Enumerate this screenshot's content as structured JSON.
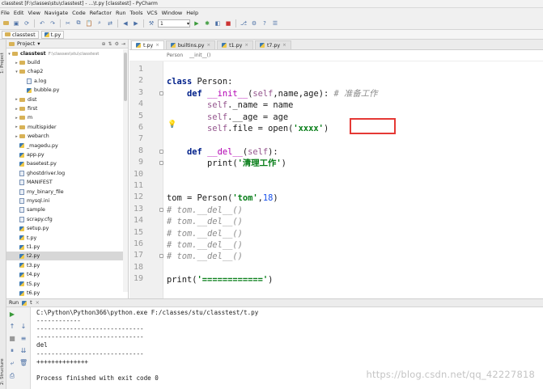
{
  "window": {
    "title": "classtest [F:\\classes\\stu\\classtest] - ...\\t.py [classtest] - PyCharm"
  },
  "menu": [
    "File",
    "Edit",
    "View",
    "Navigate",
    "Code",
    "Refactor",
    "Run",
    "Tools",
    "VCS",
    "Window",
    "Help"
  ],
  "toolbar": {
    "run_config": "1"
  },
  "navbar": {
    "project": "classtest",
    "file": "t.py"
  },
  "project_panel": {
    "header": "Project",
    "root": {
      "name": "classtest",
      "path": "F:\\classes\\stu\\classtest"
    },
    "items": [
      {
        "label": "build",
        "kind": "folder",
        "level": 1,
        "arrow": "▸"
      },
      {
        "label": "chap2",
        "kind": "folder",
        "level": 1,
        "arrow": "▾"
      },
      {
        "label": "a.log",
        "kind": "file",
        "level": 2,
        "arrow": ""
      },
      {
        "label": "bubble.py",
        "kind": "py",
        "level": 2,
        "arrow": ""
      },
      {
        "label": "dist",
        "kind": "folder",
        "level": 1,
        "arrow": "▸"
      },
      {
        "label": "first",
        "kind": "folder",
        "level": 1,
        "arrow": "▸"
      },
      {
        "label": "m",
        "kind": "folder",
        "level": 1,
        "arrow": "▸"
      },
      {
        "label": "multispider",
        "kind": "folder",
        "level": 1,
        "arrow": "▸"
      },
      {
        "label": "webarch",
        "kind": "folder",
        "level": 1,
        "arrow": "▸"
      },
      {
        "label": "_magedu.py",
        "kind": "py",
        "level": 1,
        "arrow": ""
      },
      {
        "label": "app.py",
        "kind": "py",
        "level": 1,
        "arrow": ""
      },
      {
        "label": "basetest.py",
        "kind": "py",
        "level": 1,
        "arrow": ""
      },
      {
        "label": "ghostdriver.log",
        "kind": "file",
        "level": 1,
        "arrow": ""
      },
      {
        "label": "MANIFEST",
        "kind": "file",
        "level": 1,
        "arrow": ""
      },
      {
        "label": "my_binary_file",
        "kind": "file",
        "level": 1,
        "arrow": ""
      },
      {
        "label": "mysql.ini",
        "kind": "file",
        "level": 1,
        "arrow": ""
      },
      {
        "label": "sample",
        "kind": "file",
        "level": 1,
        "arrow": ""
      },
      {
        "label": "scrapy.cfg",
        "kind": "file",
        "level": 1,
        "arrow": ""
      },
      {
        "label": "setup.py",
        "kind": "py",
        "level": 1,
        "arrow": ""
      },
      {
        "label": "t.py",
        "kind": "py",
        "level": 1,
        "arrow": ""
      },
      {
        "label": "t1.py",
        "kind": "py",
        "level": 1,
        "arrow": ""
      },
      {
        "label": "t2.py",
        "kind": "py",
        "level": 1,
        "arrow": "",
        "selected": true
      },
      {
        "label": "t3.py",
        "kind": "py",
        "level": 1,
        "arrow": ""
      },
      {
        "label": "t4.py",
        "kind": "py",
        "level": 1,
        "arrow": ""
      },
      {
        "label": "t5.py",
        "kind": "py",
        "level": 1,
        "arrow": ""
      },
      {
        "label": "t6.py",
        "kind": "py",
        "level": 1,
        "arrow": ""
      }
    ]
  },
  "editor": {
    "tabs": [
      {
        "label": "t.py",
        "active": true
      },
      {
        "label": "builtins.py",
        "active": false
      },
      {
        "label": "t1.py",
        "active": false
      },
      {
        "label": "t7.py",
        "active": false
      }
    ],
    "breadcrumb": [
      "Person",
      "__init__()"
    ],
    "current_line": 6,
    "line_numbers": [
      "1",
      "2",
      "3",
      "4",
      "5",
      "6",
      "7",
      "8",
      "9",
      "10",
      "11",
      "12",
      "13",
      "14",
      "15",
      "16",
      "17",
      "18",
      "19"
    ],
    "lines": [
      {
        "n": 1,
        "html": ""
      },
      {
        "n": 2,
        "html": "<span class=\"kw\">class</span> Person:"
      },
      {
        "n": 3,
        "html": "    <span class=\"kw\">def</span> <span class=\"fn\">__init__</span>(<span class=\"prm\">self</span>,name,age): <span class=\"cm\"># 准备工作</span>"
      },
      {
        "n": 4,
        "html": "        <span class=\"prm\">self</span>._name = name"
      },
      {
        "n": 5,
        "html": "        <span class=\"prm\">self</span>.__age = age"
      },
      {
        "n": 6,
        "html": "        <span class=\"prm\">self</span>.file = open(<span class=\"str\">'xxxx'</span>)"
      },
      {
        "n": 7,
        "html": ""
      },
      {
        "n": 8,
        "html": "    <span class=\"kw\">def</span> <span class=\"fn\">__del__</span>(<span class=\"prm\">self</span>):"
      },
      {
        "n": 9,
        "html": "        print(<span class=\"str\">'清理工作'</span>)"
      },
      {
        "n": 10,
        "html": ""
      },
      {
        "n": 11,
        "html": ""
      },
      {
        "n": 12,
        "html": "tom = Person(<span class=\"str\">'tom'</span>,<span class=\"num\">18</span>)"
      },
      {
        "n": 13,
        "html": "<span class=\"cm\"># tom.__del__()</span>"
      },
      {
        "n": 14,
        "html": "<span class=\"cm\"># tom.__del__()</span>"
      },
      {
        "n": 15,
        "html": "<span class=\"cm\"># tom.__del__()</span>"
      },
      {
        "n": 16,
        "html": "<span class=\"cm\"># tom.__del__()</span>"
      },
      {
        "n": 17,
        "html": "<span class=\"cm\"># tom.__del__()</span>"
      },
      {
        "n": 18,
        "html": ""
      },
      {
        "n": 19,
        "html": "print(<span class=\"str\">'============'</span>)"
      }
    ]
  },
  "run_panel": {
    "header": "Run",
    "tab": "t",
    "output": [
      "C:\\Python\\Python366\\python.exe F:/classes/stu/classtest/t.py",
      "------------",
      "-----------------------------",
      "-----------------------------",
      "del",
      "-----------------------------",
      "++++++++++++++",
      "",
      "Process finished with exit code 0"
    ]
  },
  "side_tabs": [
    "1: Project",
    "2: Structure"
  ],
  "watermark": "https://blog.csdn.net/qq_42227818",
  "colors": {
    "keyword": "#00208a",
    "string": "#067d17",
    "comment": "#8c8c8c",
    "highlight_box": "#e53935",
    "current_line": "#fcfaed"
  }
}
